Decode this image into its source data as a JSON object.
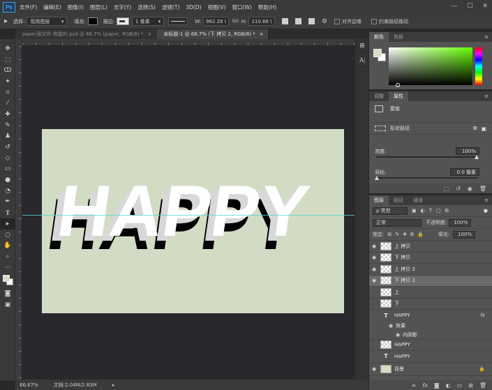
{
  "app": {
    "logo": "Ps",
    "menus": [
      "文件(F)",
      "编辑(E)",
      "图像(I)",
      "图层(L)",
      "文字(Y)",
      "选择(S)",
      "滤镜(T)",
      "3D(D)",
      "视图(V)",
      "窗口(W)",
      "帮助(H)"
    ],
    "window_controls": [
      "—",
      "☐",
      "✕"
    ]
  },
  "options": {
    "select_label": "选择:",
    "select_value": "现用图层",
    "fill_label": "填充:",
    "stroke_label": "描边:",
    "stroke_width": "1 像素",
    "w_label": "W:",
    "w_value": "962.28 (",
    "link": "GO",
    "h_label": "H:",
    "h_value": "210.66 (",
    "align_edges": "对齐边缘",
    "constrain_path": "约束路径拖动"
  },
  "tabs": [
    {
      "label": "paper源文件-恢复的.psd @ 66.7% (paper, RGB/8) *",
      "close": "×"
    },
    {
      "label": "未标题-1 @ 66.7% (下 拷贝 2, RGB/8) *",
      "close": "×"
    }
  ],
  "canvas": {
    "text": "HAPPY",
    "artboard_color": "#d2dcc4"
  },
  "status": {
    "zoom": "66.67%",
    "doc": "文档:2.04M/2.83M",
    "arrow": "▸"
  },
  "color_panel": {
    "tabs": [
      "颜色",
      "色板"
    ],
    "foreground": "#d4ddc5",
    "background": "#ffffff"
  },
  "props_panel": {
    "tabs": [
      "调整",
      "属性"
    ],
    "mask_label": "蒙版",
    "path_label": "形状路径",
    "density_label": "浓度:",
    "density_value": "100%",
    "feather_label": "羽化:",
    "feather_value": "0.0 像素"
  },
  "layers_panel": {
    "tabs": [
      "图层",
      "路径",
      "通道"
    ],
    "filter_kind": "ρ 类型",
    "blend_mode": "正常",
    "opacity_label": "不透明度:",
    "opacity_value": "100%",
    "lock_label": "锁定:",
    "fill_label": "填充:",
    "fill_value": "100%",
    "layers": [
      {
        "name": "上 拷贝",
        "kind": "shape",
        "visible": true
      },
      {
        "name": "下 拷贝",
        "kind": "shape",
        "visible": true
      },
      {
        "name": "上 拷贝 2",
        "kind": "shape",
        "visible": true
      },
      {
        "name": "下 拷贝 2",
        "kind": "shape",
        "visible": true,
        "selected": true
      },
      {
        "name": "上",
        "kind": "shape",
        "visible": false
      },
      {
        "name": "下",
        "kind": "shape",
        "visible": false
      },
      {
        "name": "HAPPY",
        "kind": "text",
        "visible": false,
        "fx": "fx"
      },
      {
        "name": "效果",
        "kind": "effect",
        "visible": true
      },
      {
        "name": "内阴影",
        "kind": "effect-item",
        "visible": true
      },
      {
        "name": "HAPPY",
        "kind": "shape",
        "visible": false
      },
      {
        "name": "HAPPY",
        "kind": "text",
        "visible": false
      },
      {
        "name": "背景",
        "kind": "background",
        "visible": true
      }
    ]
  }
}
